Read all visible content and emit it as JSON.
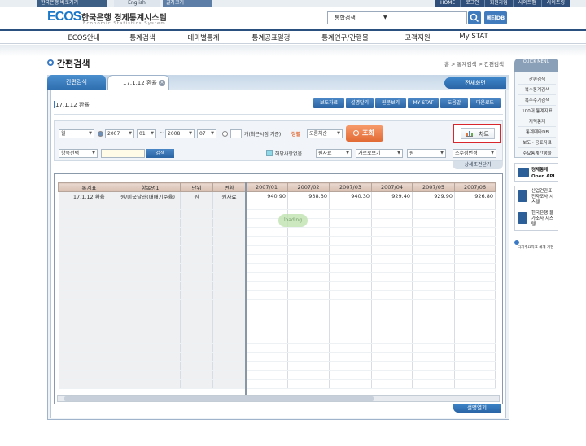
{
  "topbar": {
    "bank_link": "한국은행 바로가기",
    "english": "English",
    "font_size": "글자크기",
    "right_links": [
      "HOME",
      "로그인",
      "회원가입",
      "사이트맵",
      "사이트링"
    ]
  },
  "header": {
    "logo_mark": "ECOS",
    "logo_korean": "한국은행 경제통계시스템",
    "logo_english": "Economic Statistics System",
    "search_select": "통합검색",
    "metadb_label": "메타DB"
  },
  "nav": {
    "items": [
      "ECOS안내",
      "통계검색",
      "테마별통계",
      "통계공표일정",
      "통계연구/간행물",
      "고객지원",
      "My STAT"
    ]
  },
  "page": {
    "title": "간편검색",
    "breadcrumb": "홈 > 통계검색 > 간편검색"
  },
  "quick_menu": {
    "header": "QUICK MENU",
    "items": [
      "간편검색",
      "복수통계검색",
      "복수주기검색",
      "100대 통계지표",
      "지역통계",
      "통계메타DB",
      "보도 · 공표자료",
      "주요통계간행물"
    ],
    "open_api": "경제통계 Open API",
    "survey1": "산업연관표 전자조사 시스템",
    "survey2": "한국은행 물가조사 시스템",
    "bottom": "국가주요지표 체계 개편"
  },
  "tabs": {
    "tab1": "간편검색",
    "tab2": "17.1.12 환율",
    "close_symbol": "×",
    "all_tab": "전체화면"
  },
  "stat": {
    "name": "17.1.12 환율",
    "actions": [
      "보도자료",
      "설명달기",
      "원문보기",
      "MY STAT",
      "도움말",
      "다운로드"
    ]
  },
  "controls": {
    "period": "월",
    "from_year": "2007",
    "from_month": "01",
    "to_year": "2008",
    "to_month": "07",
    "tilde": "~",
    "recent_label": "개(최근시점 기준)",
    "sort_label": "정렬",
    "sort_value": "오름차순",
    "query_label": "조회",
    "chart_label": "차트",
    "item_select": "항목선택",
    "search_label": "검색",
    "na_label": "해당사항없음",
    "raw_data": "원자료",
    "horizontal": "가로로보기",
    "unit": "원",
    "decimal": "소수점변경",
    "detail_label": "상세조건닫기"
  },
  "grid": {
    "headers": [
      "통계표",
      "항목명1",
      "단위",
      "변환",
      "2007/01",
      "2007/02",
      "2007/03",
      "2007/04",
      "2007/05",
      "2007/06"
    ],
    "rows": [
      [
        "17.1.12 환율",
        "원/미국달러(매매기준율)",
        "원",
        "원자료",
        "940.90",
        "938.30",
        "940.30",
        "929.40",
        "929.90",
        "926.80"
      ]
    ],
    "loading_text": "loading"
  },
  "footer": {
    "explain_label": "설명열기"
  }
}
